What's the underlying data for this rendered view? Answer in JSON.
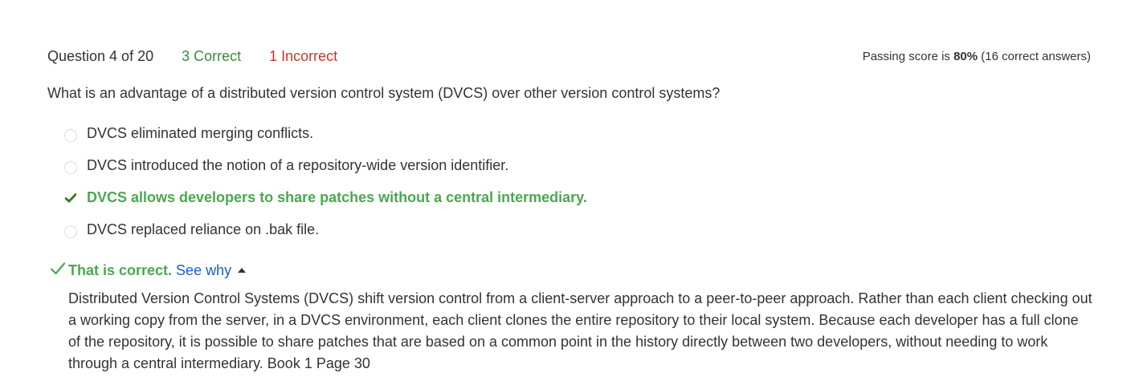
{
  "header": {
    "question_counter": "Question 4 of 20",
    "correct_count": "3 Correct",
    "incorrect_count": "1 Incorrect",
    "passing_prefix": "Passing score is ",
    "passing_percent": "80%",
    "passing_suffix": " (16 correct answers)"
  },
  "question": {
    "text": "What is an advantage of a distributed version control system (DVCS) over other version control systems?"
  },
  "options": [
    {
      "label": "DVCS eliminated merging conflicts.",
      "state": "unselected"
    },
    {
      "label": "DVCS introduced the notion of a repository-wide version identifier.",
      "state": "unselected"
    },
    {
      "label": "DVCS allows developers to share patches without a central intermediary.",
      "state": "correct-selected"
    },
    {
      "label": "DVCS replaced reliance on .bak file.",
      "state": "unselected"
    }
  ],
  "result": {
    "text": "That is correct.",
    "see_why_label": "See why"
  },
  "explanation": {
    "text": "Distributed Version Control Systems (DVCS) shift version control from a client-server approach to a peer-to-peer approach. Rather than each client checking out a working copy from the server, in a DVCS environment, each client clones the entire repository to their local system. Because each developer has a full clone of the repository, it is possible to share patches that are based on a common point in the history directly between two developers, without needing to work through a central intermediary. Book 1 Page 30"
  },
  "colors": {
    "correct": "#4aa84f",
    "correct_count": "#3b8a3e",
    "incorrect": "#c0392b",
    "link": "#1a5fc8"
  },
  "icons": {
    "selected_option": "check-icon",
    "result": "check-icon",
    "toggle": "caret-up-icon"
  }
}
